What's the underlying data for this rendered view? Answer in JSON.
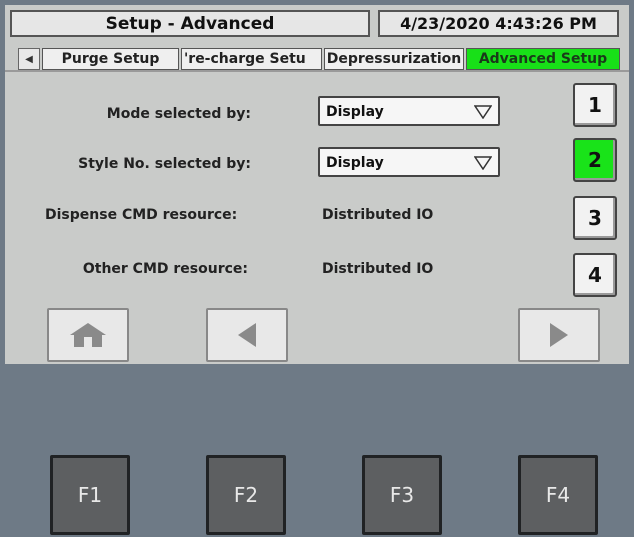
{
  "header": {
    "title": "Setup - Advanced",
    "datetime": "4/23/2020 4:43:26 PM"
  },
  "tabs": [
    {
      "label": "Purge Setup",
      "active": false
    },
    {
      "label": "'re-charge Setu",
      "active": false
    },
    {
      "label": "Depressurization",
      "active": false
    },
    {
      "label": "Advanced Setup",
      "active": true
    }
  ],
  "fields": {
    "mode_label": "Mode selected by:",
    "mode_value": "Display",
    "style_label": "Style No. selected by:",
    "style_value": "Display",
    "dispense_label": "Dispense CMD resource:",
    "dispense_value": "Distributed IO",
    "other_label": "Other CMD resource:",
    "other_value": "Distributed IO"
  },
  "side_buttons": [
    {
      "label": "1",
      "active": false
    },
    {
      "label": "2",
      "active": true
    },
    {
      "label": "3",
      "active": false
    },
    {
      "label": "4",
      "active": false
    }
  ],
  "nav": {
    "home_icon": "home-icon",
    "back_icon": "triangle-left-icon",
    "forward_icon": "triangle-right-icon"
  },
  "fkeys": [
    "F1",
    "F2",
    "F3",
    "F4"
  ],
  "colors": {
    "active_green": "#18e018",
    "screen_bg": "#c9cbc9",
    "bezel": "#6e7a86"
  }
}
